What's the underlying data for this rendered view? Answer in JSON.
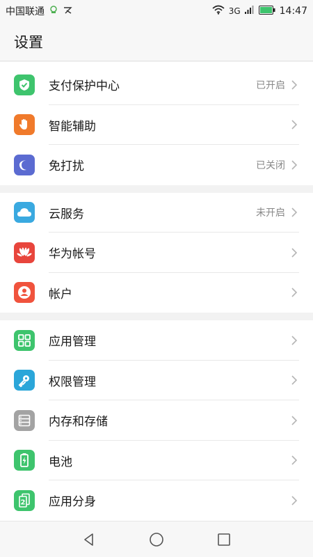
{
  "statusbar": {
    "carrier": "中国联通",
    "network": "3G",
    "time": "14:47"
  },
  "header": {
    "title": "设置"
  },
  "groups": [
    {
      "items": [
        {
          "label": "支付保护中心",
          "status": "已开启",
          "icon": "shield-check-icon",
          "color": "#3ec46d"
        },
        {
          "label": "智能辅助",
          "status": "",
          "icon": "hand-icon",
          "color": "#f07a2b"
        },
        {
          "label": "免打扰",
          "status": "已关闭",
          "icon": "moon-icon",
          "color": "#5b6bd1"
        }
      ]
    },
    {
      "items": [
        {
          "label": "云服务",
          "status": "未开启",
          "icon": "cloud-icon",
          "color": "#3aa9e0"
        },
        {
          "label": "华为帐号",
          "status": "",
          "icon": "huawei-logo-icon",
          "color": "#e8453c"
        },
        {
          "label": "帐户",
          "status": "",
          "icon": "user-icon",
          "color": "#f0533d"
        }
      ]
    },
    {
      "items": [
        {
          "label": "应用管理",
          "status": "",
          "icon": "apps-grid-icon",
          "color": "#3ec46d"
        },
        {
          "label": "权限管理",
          "status": "",
          "icon": "key-icon",
          "color": "#2ba6d9"
        },
        {
          "label": "内存和存储",
          "status": "",
          "icon": "storage-icon",
          "color": "#a3a3a3"
        },
        {
          "label": "电池",
          "status": "",
          "icon": "battery-icon",
          "color": "#3ec46d"
        },
        {
          "label": "应用分身",
          "status": "",
          "icon": "app-twin-icon",
          "color": "#3ec46d"
        }
      ]
    }
  ]
}
